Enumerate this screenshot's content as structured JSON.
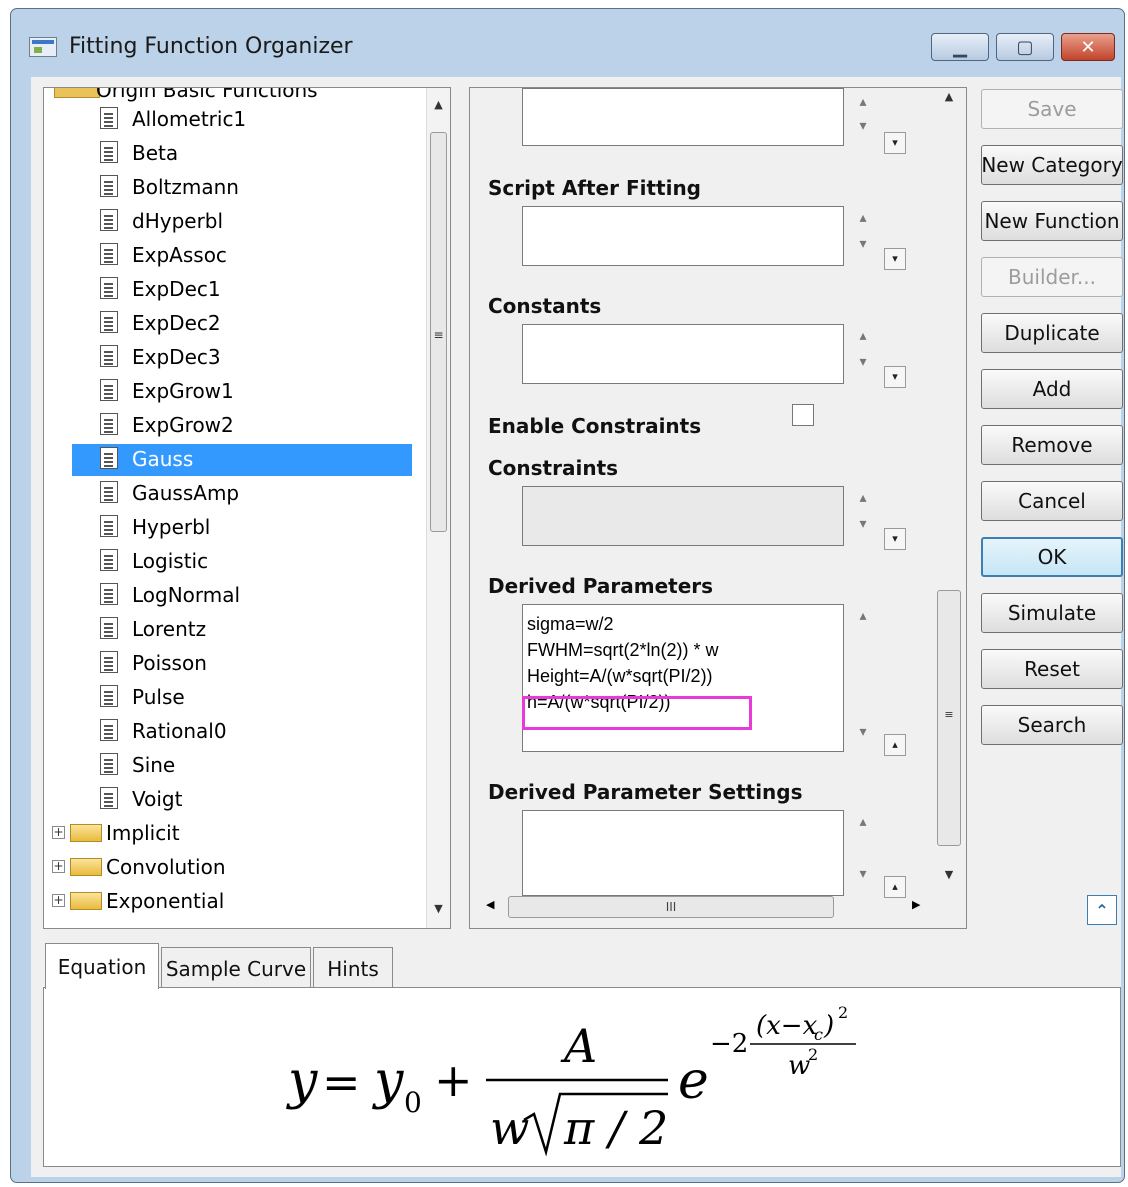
{
  "window": {
    "title": "Fitting Function Organizer",
    "controls": [
      "minimize",
      "maximize",
      "close"
    ]
  },
  "tree": {
    "parent_label": "Origin Basic Functions",
    "functions": [
      "Allometric1",
      "Beta",
      "Boltzmann",
      "dHyperbl",
      "ExpAssoc",
      "ExpDec1",
      "ExpDec2",
      "ExpDec3",
      "ExpGrow1",
      "ExpGrow2",
      "Gauss",
      "GaussAmp",
      "Hyperbl",
      "Logistic",
      "LogNormal",
      "Lorentz",
      "Poisson",
      "Pulse",
      "Rational0",
      "Sine",
      "Voigt"
    ],
    "selected": "Gauss",
    "folders": [
      "Implicit",
      "Convolution",
      "Exponential"
    ]
  },
  "middle": {
    "script_after_fitting_label": "Script After Fitting",
    "constants_label": "Constants",
    "enable_constraints_label": "Enable Constraints",
    "enable_constraints_checked": false,
    "constraints_label": "Constraints",
    "derived_parameters_label": "Derived Parameters",
    "derived_parameters": [
      "sigma=w/2",
      "FWHM=sqrt(2*ln(2)) * w",
      "Height=A/(w*sqrt(PI/2))",
      "h=A/(w*sqrt(PI/2))"
    ],
    "derived_parameter_settings_label": "Derived Parameter Settings",
    "hscroll_grip": "III"
  },
  "buttons": {
    "save": "Save",
    "new_category": "New Category",
    "new_function": "New Function",
    "builder": "Builder...",
    "duplicate": "Duplicate",
    "add": "Add",
    "remove": "Remove",
    "cancel": "Cancel",
    "ok": "OK",
    "simulate": "Simulate",
    "reset": "Reset",
    "search": "Search"
  },
  "tabs": [
    "Equation",
    "Sample Curve",
    "Hints"
  ],
  "active_tab": "Equation",
  "equation": {
    "lhs": "y",
    "y0": "y",
    "y0_sub": "0",
    "numerator": "A",
    "denominator_w": "w",
    "denominator_radicand": "π / 2",
    "base": "e",
    "exp_coef": "−2",
    "exp_num": "(x−x",
    "exp_num_sub": "c",
    "exp_num_close": ")",
    "exp_num_pow": "2",
    "exp_den": "w",
    "exp_den_pow": "2"
  },
  "colors": {
    "selection": "#3399ff",
    "highlight_box": "#e83ad8",
    "window_frame": "#bcd2e8",
    "default_button": "#3c7fb1"
  }
}
